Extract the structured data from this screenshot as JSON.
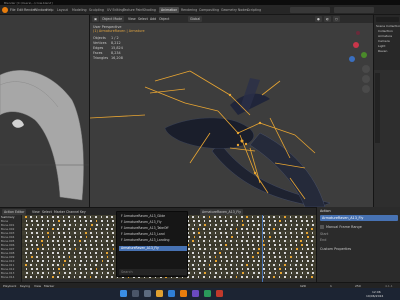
{
  "window": {
    "title": "Blender [C:\\Users\\...\\crow.blend]"
  },
  "menu": [
    "File",
    "Edit",
    "Render",
    "Window",
    "Help"
  ],
  "workspaces": [
    {
      "label": "Layout",
      "active": false
    },
    {
      "label": "Modeling",
      "active": false
    },
    {
      "label": "Sculpting",
      "active": false
    },
    {
      "label": "UV Editing",
      "active": false
    },
    {
      "label": "Texture Paint",
      "active": false
    },
    {
      "label": "Shading",
      "active": false
    },
    {
      "label": "Animation",
      "active": true
    },
    {
      "label": "Rendering",
      "active": false
    },
    {
      "label": "Compositing",
      "active": false
    },
    {
      "label": "Geometry Nodes",
      "active": false
    },
    {
      "label": "Scripting",
      "active": false
    }
  ],
  "viewport_header": {
    "mode": "Object Mode",
    "view": "View",
    "select": "Select",
    "add": "Add",
    "object": "Object",
    "transform": "Global"
  },
  "viewport_info": {
    "perspective": "User Perspective",
    "collection": "(1) ArmatureRaven | Armature",
    "stats": [
      {
        "label": "Objects",
        "value": "1 / 2"
      },
      {
        "label": "Vertices",
        "value": "8,212"
      },
      {
        "label": "Edges",
        "value": "15,824"
      },
      {
        "label": "Faces",
        "value": "8,234"
      },
      {
        "label": "Triangles",
        "value": "16,208"
      }
    ]
  },
  "outliner": {
    "search_placeholder": "Search",
    "items": [
      "Scene Collection",
      "Collection",
      "Armature",
      "Camera",
      "Light",
      "Raven"
    ]
  },
  "dopesheet": {
    "mode": "Action Editor",
    "view": "View",
    "select": "Select",
    "marker": "Marker",
    "channel": "Channel",
    "key": "Key",
    "action_field": "ArmatureRaven_A13_Fly",
    "channels": [
      "Summary",
      "Bone",
      "Bone.001",
      "Bone.002",
      "Bone.003",
      "Bone.004",
      "Bone.005",
      "Bone.006",
      "Bone.007",
      "Bone.008",
      "Bone.009",
      "Bone.010",
      "Bone.011",
      "Bone.012",
      "Bone.013",
      "Bone.014"
    ],
    "ruler": [
      "0",
      "10",
      "20",
      "30",
      "40",
      "50",
      "60",
      "70",
      "80",
      "90",
      "100",
      "110",
      "120"
    ]
  },
  "action_popup": {
    "items": [
      {
        "label": "F ArmatureRaven_A13_Glide",
        "selected": false
      },
      {
        "label": "F ArmatureRaven_A13_Fly",
        "selected": false
      },
      {
        "label": "F ArmatureRaven_A13_TakeOff",
        "selected": false
      },
      {
        "label": "F ArmatureRaven_A13_Land",
        "selected": false
      },
      {
        "label": "F ArmatureRaven_A13_Landing",
        "selected": false
      },
      {
        "label": "ArmatureRaven_A13_Fly",
        "selected": true
      }
    ],
    "search_placeholder": "Search"
  },
  "nla_panel": {
    "header": "Action",
    "action_label": "ArmatureRaven_A13_Fly",
    "manual_range": "Manual Frame Range",
    "start": "Start",
    "end": "End",
    "custom_props": "Custom Properties"
  },
  "timeline": {
    "playback": "Playback",
    "keying": "Keying",
    "view": "View",
    "marker": "Marker",
    "current_frame": "120",
    "start": "1",
    "end": "250"
  },
  "status_bar": {
    "left": "Select Fly Action",
    "right": "4.1.1"
  },
  "taskbar": {
    "clock": "12:06",
    "date": "19/06/2024"
  },
  "colors": {
    "accent": "#4772b3",
    "bone": "#e8a532",
    "selected_key": "#e8a532"
  }
}
